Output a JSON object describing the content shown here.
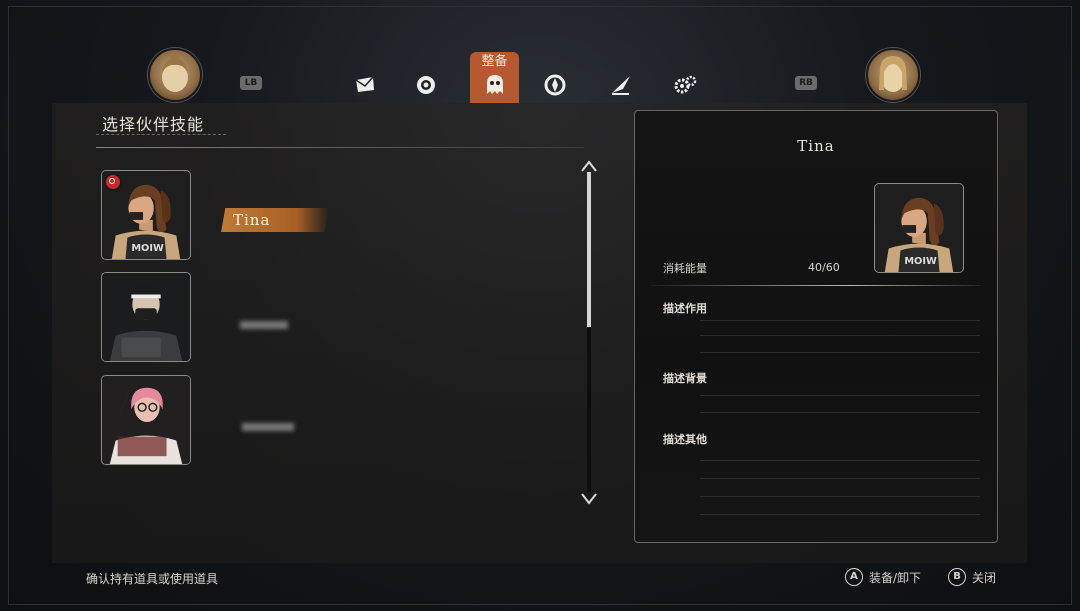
{
  "nav": {
    "lb_label": "LB",
    "rb_label": "RB",
    "active_tab_label": "整备",
    "tabs": [
      "mail-icon",
      "eye-icon",
      "ghost-icon",
      "compass-icon",
      "quill-icon",
      "gears-icon"
    ],
    "accent_color": "#b65830"
  },
  "left_panel": {
    "title": "选择伙伴技能",
    "companions": [
      {
        "name": "Tina",
        "equipped": true
      },
      {
        "name": "",
        "equipped": false
      },
      {
        "name": "",
        "equipped": false
      }
    ]
  },
  "detail": {
    "name": "Tina",
    "energy_label": "消耗能量",
    "energy_value": "40/60",
    "effect_label": "描述作用",
    "background_label": "描述背景",
    "other_label": "描述其他"
  },
  "footer": {
    "hint": "确认持有道具或使用道具",
    "a_button": "A",
    "a_label": "装备/卸下",
    "b_button": "B",
    "b_label": "关闭"
  }
}
